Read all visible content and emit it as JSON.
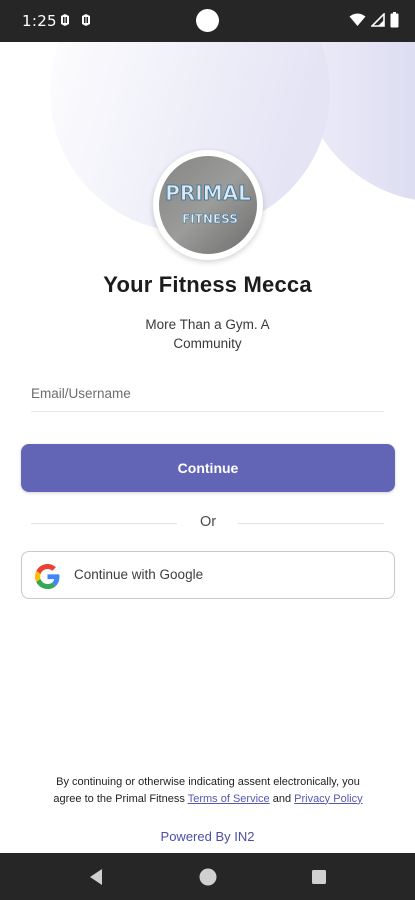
{
  "status_bar": {
    "time": "1:25",
    "icons": [
      "notification-icon",
      "notification-icon",
      "wifi-icon",
      "signal-icon",
      "battery-icon"
    ]
  },
  "colors": {
    "accent": "#6264b5",
    "link": "#5558b0",
    "status_bar_bg": "#262626"
  },
  "logo": {
    "text_line1": "PRIMAL",
    "text_line2": "FITNESS"
  },
  "header": {
    "title": "Your Fitness Mecca",
    "subtitle": "More Than a Gym. A Community"
  },
  "form": {
    "email_placeholder": "Email/Username",
    "continue_label": "Continue",
    "divider_text": "Or",
    "google_label": "Continue with Google"
  },
  "footer": {
    "legal_text": "By continuing or otherwise indicating assent electronically, you agree to the Primal Fitness",
    "terms_link": "Terms of Service",
    "and_text": "and",
    "privacy_link": "Privacy Policy",
    "powered_by": "Powered By IN2"
  },
  "nav_bar": {
    "buttons": [
      "back-icon",
      "home-icon",
      "recents-icon"
    ]
  }
}
